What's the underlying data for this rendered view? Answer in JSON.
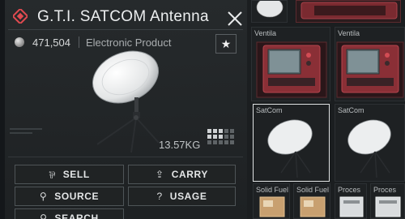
{
  "item": {
    "title": "G.T.I. SATCOM Antenna",
    "price": "471,504",
    "category": "Electronic Product",
    "weight": "13.57KG",
    "favorite_icon": "star-icon",
    "close_icon": "close-icon"
  },
  "actions": {
    "sell": "SELL",
    "carry": "CARRY",
    "source": "SOURCE",
    "usage": "USAGE",
    "search": "SEARCH"
  },
  "inventory": {
    "slots": [
      {
        "label": "Ventila"
      },
      {
        "label": "Ventila"
      },
      {
        "label": "SatCom"
      },
      {
        "label": "SatCom"
      },
      {
        "label": "Solid Fuel"
      },
      {
        "label": "Solid Fuel"
      },
      {
        "label": "Proces"
      },
      {
        "label": "Proces"
      }
    ]
  },
  "colors": {
    "accent_red": "#d9434a",
    "panel": "#26292b",
    "text": "#eceeef"
  }
}
